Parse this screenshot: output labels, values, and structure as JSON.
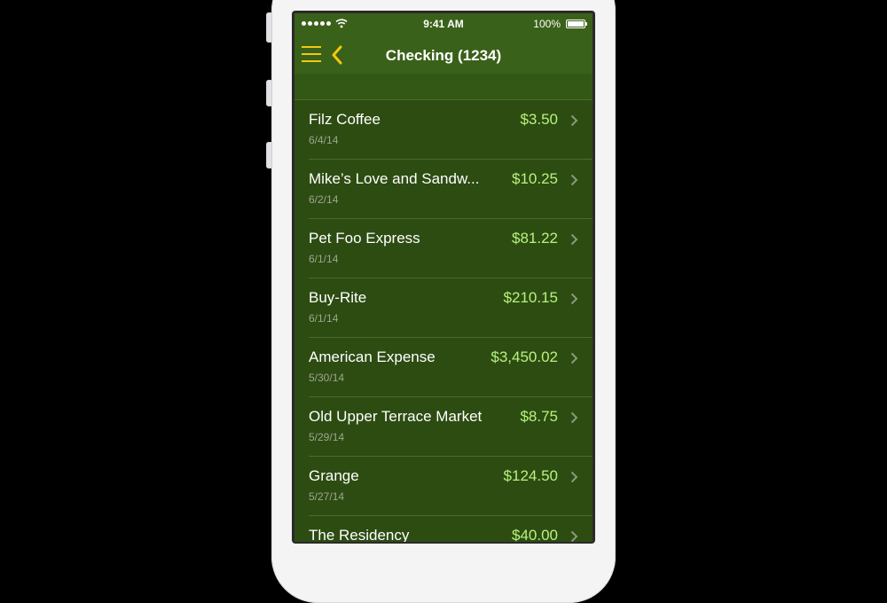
{
  "status_bar": {
    "time": "9:41 AM",
    "battery": "100%"
  },
  "nav": {
    "title": "Checking (1234)",
    "icons": {
      "menu": "menu-icon",
      "back": "chevron-left-icon"
    },
    "accent_color": "#f3c80e"
  },
  "colors": {
    "nav_background": "#3a6119",
    "list_background": "#2d4c12",
    "amount_text": "#b8f27e",
    "date_text": "#9ea58e"
  },
  "transactions": [
    {
      "name": "Filz Coffee",
      "date": "6/4/14",
      "amount": "$3.50"
    },
    {
      "name": "Mike’s Love and Sandw...",
      "date": "6/2/14",
      "amount": "$10.25"
    },
    {
      "name": "Pet Foo Express",
      "date": "6/1/14",
      "amount": "$81.22"
    },
    {
      "name": "Buy-Rite",
      "date": "6/1/14",
      "amount": "$210.15"
    },
    {
      "name": "American Expense",
      "date": "5/30/14",
      "amount": "$3,450.02"
    },
    {
      "name": "Old Upper Terrace Market",
      "date": "5/29/14",
      "amount": "$8.75"
    },
    {
      "name": "Grange",
      "date": "5/27/14",
      "amount": "$124.50"
    },
    {
      "name": "The Residency",
      "date": "",
      "amount": "$40.00"
    }
  ]
}
